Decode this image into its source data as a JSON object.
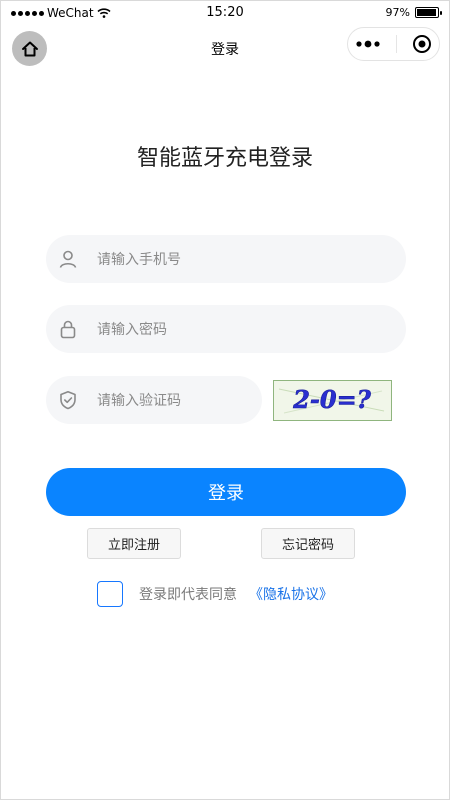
{
  "status_bar": {
    "carrier": "WeChat",
    "time": "15:20",
    "battery_text": "97%",
    "battery_level": 0.97
  },
  "nav": {
    "title": "登录",
    "home_icon": "home-icon",
    "more_icon": "more-dots-icon",
    "close_icon": "target-circle-icon"
  },
  "page": {
    "heading": "智能蓝牙充电登录"
  },
  "form": {
    "phone": {
      "placeholder": "请输入手机号",
      "value": ""
    },
    "password": {
      "placeholder": "请输入密码",
      "value": ""
    },
    "captcha_code": {
      "placeholder": "请输入验证码",
      "value": ""
    },
    "captcha_image_text": "2-0=?"
  },
  "actions": {
    "login_label": "登录",
    "register_label": "立即注册",
    "forgot_label": "忘记密码"
  },
  "agreement": {
    "checked": false,
    "text": "登录即代表同意",
    "link": "《隐私协议》"
  },
  "colors": {
    "primary": "#0a84ff",
    "link": "#1a73e8",
    "field_bg": "#f5f6f8",
    "captcha_text": "#2a2fd0"
  }
}
